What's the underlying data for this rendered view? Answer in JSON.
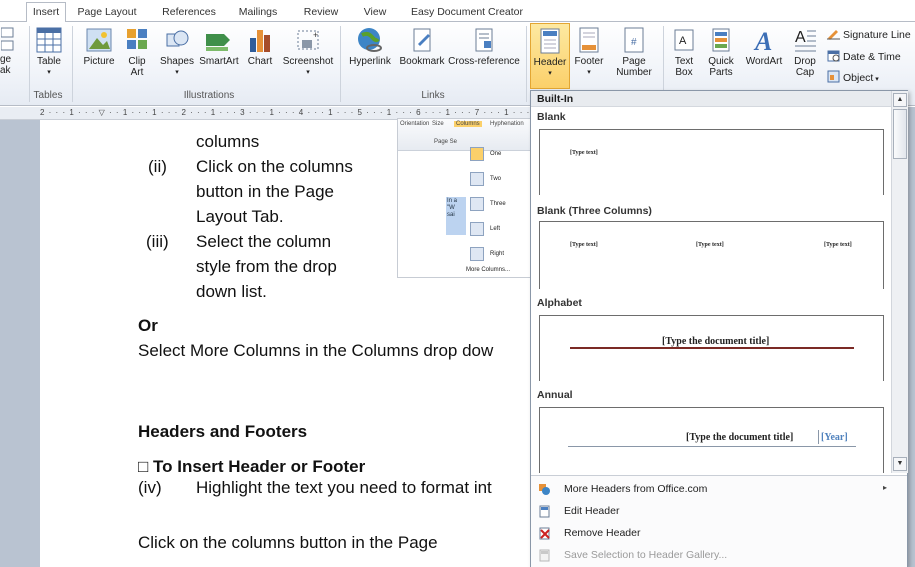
{
  "tabs": [
    "Insert",
    "Page Layout",
    "References",
    "Mailings",
    "Review",
    "View",
    "Easy Document Creator"
  ],
  "active_tab": "Insert",
  "ribbon": {
    "page_break_label_partial": [
      "ge",
      "ak"
    ],
    "table_label": "Table",
    "picture_label": "Picture",
    "clip_art_label": "Clip Art",
    "shapes_label": "Shapes",
    "smartart_label": "SmartArt",
    "chart_label": "Chart",
    "screenshot_label": "Screenshot",
    "hyperlink_label": "Hyperlink",
    "bookmark_label": "Bookmark",
    "crossref_label": "Cross-reference",
    "header_label": "Header",
    "footer_label": "Footer",
    "page_number_label": "Page Number",
    "text_box_label": "Text Box",
    "quick_parts_label": "Quick Parts",
    "wordart_label": "WordArt",
    "drop_cap_label": "Drop Cap",
    "signature_line_label": "Signature Line",
    "date_time_label": "Date & Time",
    "object_label": "Object",
    "groups": {
      "tables": "Tables",
      "illustrations": "Illustrations",
      "links": "Links"
    }
  },
  "ruler": {
    "text": "2 · · · 1 · · · ▽ · · 1 · · · 1 · · · 2 · · · 1 · · · 3 · · · 1 · · · 4 · · · 1 · · · 5 · · · 1 · · · 6 · · · 1 · · · 7 · · · 1 · · · 8 · · ·"
  },
  "document": {
    "lines": {
      "columns": "columns",
      "ii_num": "(ii)",
      "ii_1": "Click on the columns",
      "ii_2": "button in the Page",
      "ii_3": "Layout Tab.",
      "iii_num": "(iii)",
      "iii_1": "Select the column",
      "iii_2": "style from the drop",
      "iii_3": "down list.",
      "or": "Or",
      "select_more": "Select More Columns in the Columns drop dow",
      "headers_footers": "Headers and Footers",
      "to_insert": "□  To Insert Header or Footer",
      "iv_num": "(iv)",
      "iv_text": "Highlight the text you need to format int",
      "click_columns": "Click on the columns button in the Page"
    },
    "inset": {
      "header_items": [
        "Orientation",
        "Size",
        "Columns",
        "Hyphenation"
      ],
      "page_setup": "Page Se",
      "options": [
        "One",
        "Two",
        "Three",
        "Left",
        "Right"
      ],
      "more": "More Columns...",
      "selected_fragment": [
        "In a",
        "\"W",
        "sai"
      ]
    }
  },
  "dropdown": {
    "built_in": "Built-In",
    "sections": [
      {
        "title": "Blank",
        "placeholders": [
          "[Type text]"
        ]
      },
      {
        "title": "Blank (Three Columns)",
        "placeholders": [
          "[Type text]",
          "[Type text]",
          "[Type text]"
        ]
      },
      {
        "title": "Alphabet",
        "placeholders": [
          "[Type the document title]"
        ]
      },
      {
        "title": "Annual",
        "placeholders": [
          "[Type the document title]",
          "[Year]"
        ]
      }
    ],
    "menu": [
      {
        "label": "More Headers from Office.com",
        "has_arrow": true,
        "disabled": false
      },
      {
        "label": "Edit Header",
        "has_arrow": false,
        "disabled": false
      },
      {
        "label": "Remove Header",
        "has_arrow": false,
        "disabled": false
      },
      {
        "label": "Save Selection to Header Gallery...",
        "has_arrow": false,
        "disabled": true
      }
    ]
  },
  "colors": {
    "accent_highlight": "#fbd06a",
    "alphabet_rule": "#7b2a25",
    "annual_year": "#4f81bd"
  }
}
